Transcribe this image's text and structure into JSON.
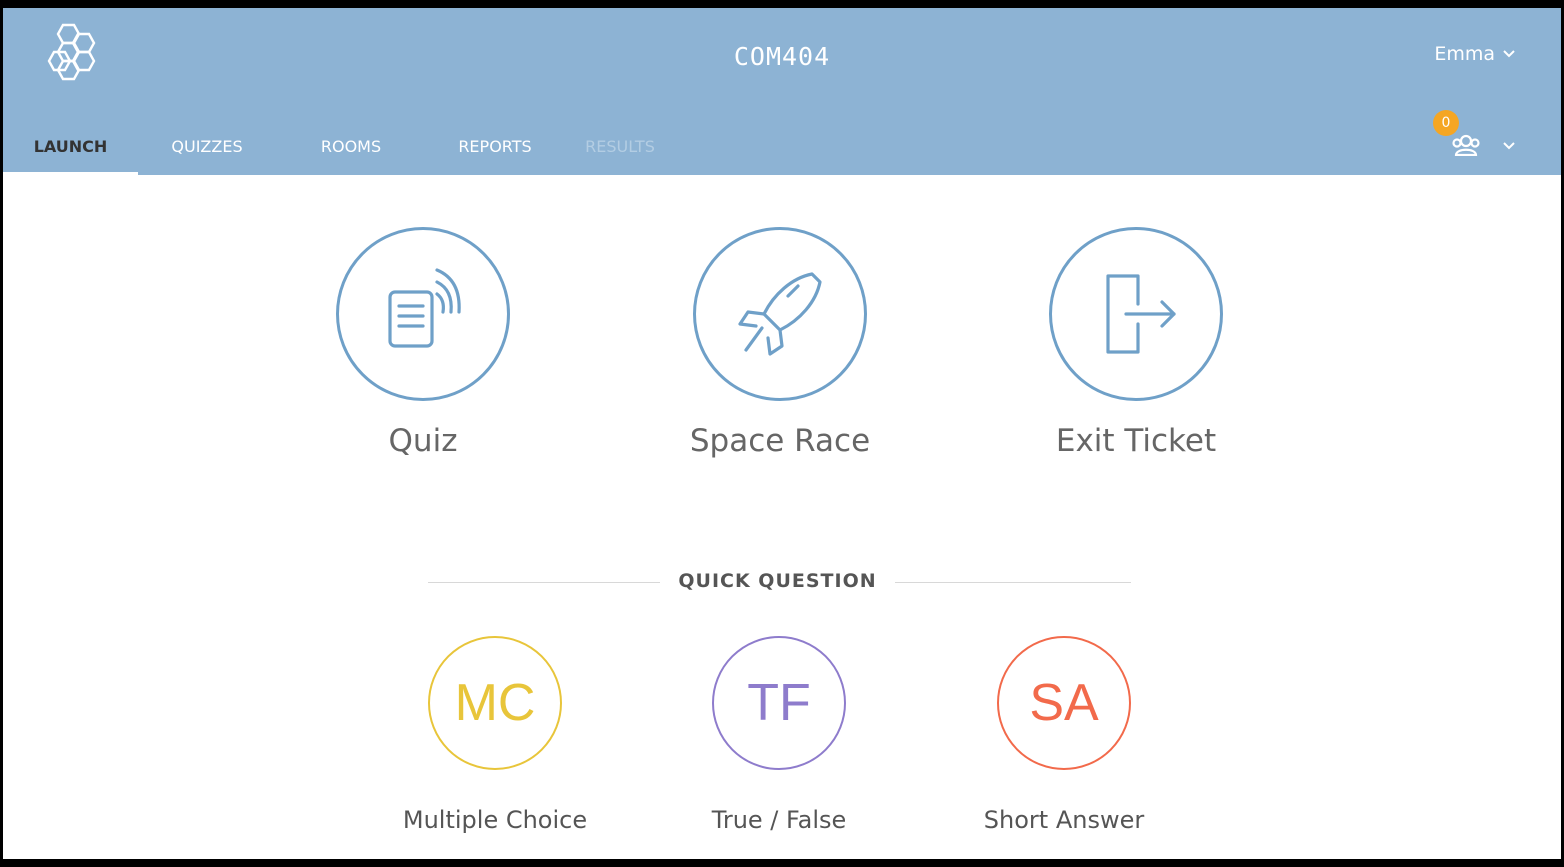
{
  "header": {
    "title": "COM404",
    "user_name": "Emma",
    "rooms_badge_count": "0",
    "logo_icon": "hexagon-molecule-icon",
    "colors": {
      "bar": "#8db3d4",
      "badge": "#f5a623"
    }
  },
  "tabs": [
    {
      "label": "LAUNCH",
      "state": "active"
    },
    {
      "label": "QUIZZES",
      "state": "normal"
    },
    {
      "label": "ROOMS",
      "state": "normal"
    },
    {
      "label": "REPORTS",
      "state": "normal"
    },
    {
      "label": "RESULTS",
      "state": "disabled"
    }
  ],
  "launch_options": [
    {
      "label": "Quiz",
      "icon": "quiz-document-icon"
    },
    {
      "label": "Space Race",
      "icon": "rocket-icon"
    },
    {
      "label": "Exit Ticket",
      "icon": "exit-door-icon"
    }
  ],
  "quick_question": {
    "title": "QUICK QUESTION",
    "options": [
      {
        "abbr": "MC",
        "label": "Multiple Choice",
        "color": "#e8c53a"
      },
      {
        "abbr": "TF",
        "label": "True / False",
        "color": "#8e7ccc"
      },
      {
        "abbr": "SA",
        "label": "Short Answer",
        "color": "#f26a4b"
      }
    ]
  }
}
